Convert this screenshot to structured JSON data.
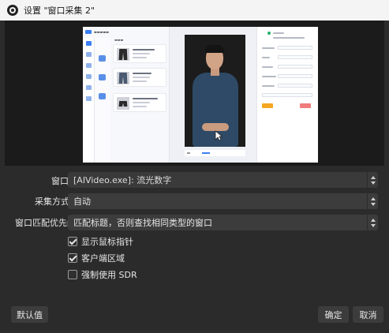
{
  "window": {
    "title": "设置 \"窗口采集 2\""
  },
  "form": {
    "window_label": "窗口",
    "window_value": "[AIVideo.exe]: 流光数字",
    "capture_method_label": "采集方式",
    "capture_method_value": "自动",
    "window_match_label": "窗口匹配优先级",
    "window_match_value": "匹配标题，否则查找相同类型的窗口",
    "checkboxes": [
      {
        "label": "显示鼠标指针",
        "checked": true
      },
      {
        "label": "客户端区域",
        "checked": true
      },
      {
        "label": "强制使用 SDR",
        "checked": false
      }
    ]
  },
  "buttons": {
    "defaults": "默认值",
    "ok": "确定",
    "cancel": "取消"
  },
  "colors": {
    "dialog_bg": "#2b2b2b",
    "control_bg": "#3c3c3c",
    "accent": "#3b7ff5"
  }
}
